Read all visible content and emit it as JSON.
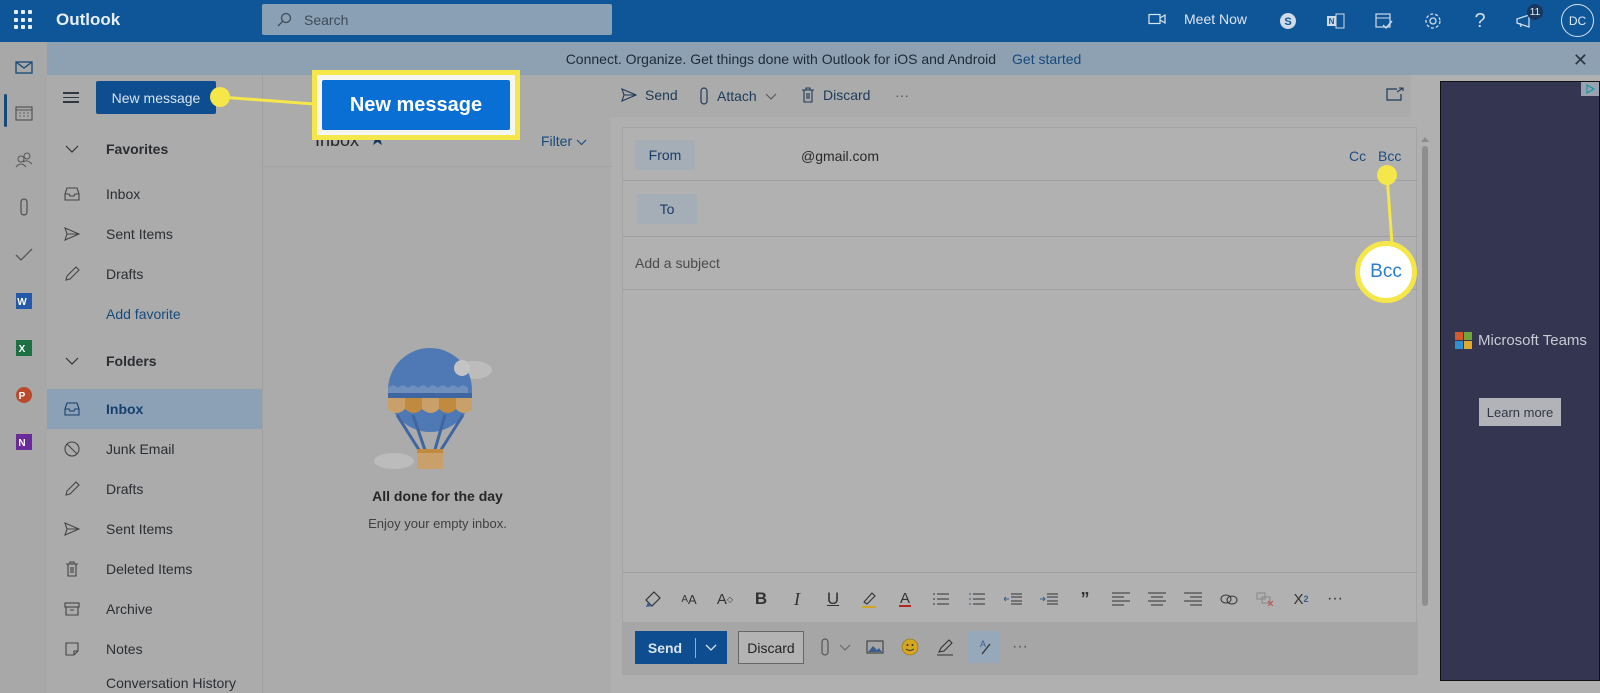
{
  "topbar": {
    "app_name": "Outlook",
    "search_placeholder": "Search",
    "meet_now_label": "Meet Now",
    "notifications_count": "11",
    "avatar_initials": "DC"
  },
  "banner": {
    "text": "Connect. Organize. Get things done with Outlook for iOS and Android",
    "link": "Get started"
  },
  "leftnav": {
    "new_message_label": "New message",
    "favorites": {
      "label": "Favorites",
      "items": [
        {
          "label": "Inbox",
          "icon": "inbox-icon"
        },
        {
          "label": "Sent Items",
          "icon": "send-icon"
        },
        {
          "label": "Drafts",
          "icon": "pencil-icon"
        }
      ],
      "add_label": "Add favorite"
    },
    "folders": {
      "label": "Folders",
      "items": [
        {
          "label": "Inbox",
          "icon": "inbox-icon",
          "selected": true
        },
        {
          "label": "Junk Email",
          "icon": "blocked-icon"
        },
        {
          "label": "Drafts",
          "icon": "pencil-icon"
        },
        {
          "label": "Sent Items",
          "icon": "send-icon"
        },
        {
          "label": "Deleted Items",
          "icon": "trash-icon"
        },
        {
          "label": "Archive",
          "icon": "archive-icon"
        },
        {
          "label": "Notes",
          "icon": "note-icon"
        },
        {
          "label": "Conversation History",
          "icon": ""
        }
      ]
    }
  },
  "maillist": {
    "title": "Inbox",
    "filter_label": "Filter",
    "empty_title": "All done for the day",
    "empty_subtitle": "Enjoy your empty inbox."
  },
  "commandbar": {
    "send": "Send",
    "attach": "Attach",
    "discard": "Discard",
    "more": "···"
  },
  "compose": {
    "from_label": "From",
    "from_value": "@gmail.com",
    "to_label": "To",
    "cc_label": "Cc",
    "bcc_label": "Bcc",
    "subject_placeholder": "Add a subject",
    "send_label": "Send",
    "discard_label": "Discard"
  },
  "ad": {
    "brand": "Microsoft Teams",
    "cta": "Learn more",
    "colors": [
      "#d45a2b",
      "#6ea63b",
      "#2f8fd0",
      "#e0a92c"
    ]
  },
  "callouts": {
    "new_message": "New message",
    "bcc": "Bcc",
    "color": "#f5e64a"
  }
}
